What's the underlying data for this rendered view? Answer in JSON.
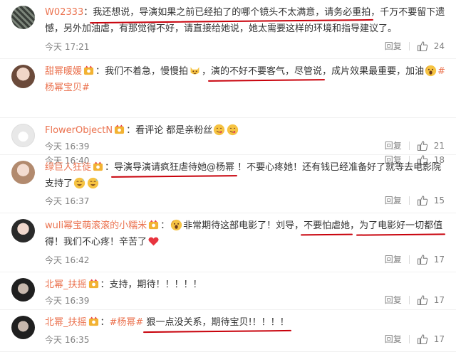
{
  "comments": [
    {
      "user": "W02333",
      "has_badge": false,
      "segments": [
        {
          "t": "：",
          "u": false
        },
        {
          "t": "我还想说，导演如果之前已经拍了的哪个镜头不太满意，请务必重拍",
          "u": true
        },
        {
          "t": "，千万不要留下遗憾，另外加油虐，有那觉得不好，请直接给她说，她太需要这样的环境和指导建议了。",
          "u": false
        }
      ],
      "time": "今天 17:21",
      "reply": "回复",
      "likes": "24"
    },
    {
      "user": "甜幂暖媛",
      "has_badge": true,
      "segments": [
        {
          "t": "：我们不着急，慢慢拍",
          "u": false
        },
        {
          "emoji": "cat-face-emoji"
        },
        {
          "t": "，",
          "u": false
        },
        {
          "t": "演的不好不要客气，尽管说",
          "u": true
        },
        {
          "t": "，成片效果最重要，加油",
          "u": false
        },
        {
          "emoji": "scream-face-emoji"
        },
        {
          "tag": "#杨幂宝贝#"
        }
      ],
      "time": "今天 16:40",
      "reply": "回复",
      "likes": "18"
    },
    {
      "user": "FlowerObjectN",
      "has_badge": true,
      "segments": [
        {
          "t": "：看评论 都是亲粉丝",
          "u": false
        },
        {
          "emoji": "yum-face-emoji"
        },
        {
          "emoji": "yum-face-emoji"
        }
      ],
      "time": "今天 16:39",
      "reply": "回复",
      "likes": "21"
    },
    {
      "user": "绿巨人狂徒",
      "has_badge": true,
      "segments": [
        {
          "t": "：",
          "u": false
        },
        {
          "t": "导演导演请疯狂虐待她@杨幂",
          "u": true,
          "mention": "@杨幂"
        },
        {
          "t": " ！不要心疼她！还有钱已经准备好了就等去电影院支持了",
          "u": false
        },
        {
          "emoji": "sweat-smile-emoji"
        },
        {
          "emoji": "sweat-smile-emoji"
        }
      ],
      "time": "今天 16:37",
      "reply": "回复",
      "likes": "15"
    },
    {
      "user": "wuli幂宝萌滚滚的小糯米",
      "has_badge": true,
      "segments": [
        {
          "t": "：",
          "u": false
        },
        {
          "emoji": "scream-face-emoji"
        },
        {
          "t": "非常期待这部电影了！刘导，",
          "u": false
        },
        {
          "t": "不要怕虐她",
          "u": true
        },
        {
          "t": "，",
          "u": false
        },
        {
          "t": "为了电影好一切都值",
          "u": true
        },
        {
          "t": "得！我们不心疼！辛苦了",
          "u": false
        },
        {
          "emoji": "heart-emoji"
        }
      ],
      "time": "今天 16:42",
      "reply": "回复",
      "likes": "17"
    },
    {
      "user": "北幂_扶摇",
      "has_badge": true,
      "segments": [
        {
          "t": "：支持，期待！！！！！",
          "u": false
        }
      ],
      "time": "今天 16:39",
      "reply": "回复",
      "likes": "17"
    },
    {
      "user": "北幂_扶摇",
      "has_badge": true,
      "segments": [
        {
          "t": "：",
          "u": false
        },
        {
          "tag": "#杨幂#"
        },
        {
          "t": " ",
          "u": false
        },
        {
          "t": "狠一点没关系，期待宝贝!！！！！",
          "u": true
        }
      ],
      "time": "今天 16:35",
      "reply": "回复",
      "likes": "17"
    }
  ],
  "colors": {
    "username": "#eb7350",
    "underline": "#c8000a",
    "meta": "#808080"
  }
}
